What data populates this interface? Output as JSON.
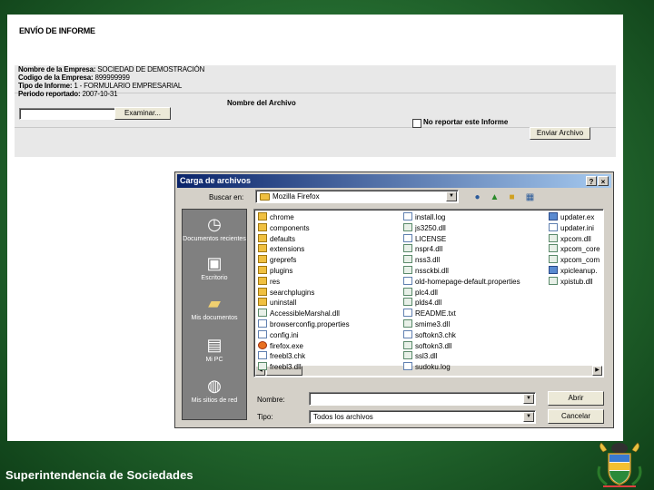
{
  "form": {
    "title": "ENVÍO DE INFORME",
    "empresa_label": "Nombre de la Empresa:",
    "empresa_value": "SOCIEDAD DE DEMOSTRACIÓN",
    "codigo_label": "Codigo de la Empresa:",
    "codigo_value": "899999999",
    "tipo_label": "Tipo de Informe:",
    "tipo_value": "1 - FORMULARIO EMPRESARIAL",
    "periodo_label": "Periodo reportado:",
    "periodo_value": "2007-10-31",
    "archivo_label": "Nombre del Archivo",
    "examinar_label": "Examinar...",
    "no_reportar_label": "No reportar este Informe",
    "enviar_label": "Enviar Archivo"
  },
  "dialog": {
    "title": "Carga de archivos",
    "help_glyph": "?",
    "close_glyph": "×",
    "buscar_label": "Buscar en:",
    "buscar_value": "Mozilla Firefox",
    "nombre_label": "Nombre:",
    "nombre_value": "",
    "tipo_label": "Tipo:",
    "tipo_value": "Todos los archivos",
    "abrir_label": "Abrir",
    "cancelar_label": "Cancelar",
    "places": [
      {
        "label": "Documentos recientes",
        "icon": "recent-documents-icon"
      },
      {
        "label": "Escritorio",
        "icon": "desktop-icon"
      },
      {
        "label": "Mis documentos",
        "icon": "my-documents-icon"
      },
      {
        "label": "Mi PC",
        "icon": "my-computer-icon"
      },
      {
        "label": "Mis sitios de red",
        "icon": "network-places-icon"
      }
    ],
    "files_col1": [
      {
        "name": "chrome",
        "type": "folder"
      },
      {
        "name": "components",
        "type": "folder"
      },
      {
        "name": "defaults",
        "type": "folder"
      },
      {
        "name": "extensions",
        "type": "folder"
      },
      {
        "name": "greprefs",
        "type": "folder"
      },
      {
        "name": "plugins",
        "type": "folder"
      },
      {
        "name": "res",
        "type": "folder"
      },
      {
        "name": "searchplugins",
        "type": "folder"
      },
      {
        "name": "uninstall",
        "type": "folder"
      },
      {
        "name": "AccessibleMarshal.dll",
        "type": "dll"
      },
      {
        "name": "browserconfig.properties",
        "type": "doc"
      },
      {
        "name": "config.ini",
        "type": "doc"
      },
      {
        "name": "firefox.exe",
        "type": "ff"
      },
      {
        "name": "freebl3.chk",
        "type": "doc"
      },
      {
        "name": "freebl3.dll",
        "type": "dll"
      }
    ],
    "files_col2": [
      {
        "name": "install.log",
        "type": "doc"
      },
      {
        "name": "js3250.dll",
        "type": "dll"
      },
      {
        "name": "LICENSE",
        "type": "doc"
      },
      {
        "name": "nspr4.dll",
        "type": "dll"
      },
      {
        "name": "nss3.dll",
        "type": "dll"
      },
      {
        "name": "nssckbi.dll",
        "type": "dll"
      },
      {
        "name": "old-homepage-default.properties",
        "type": "doc"
      },
      {
        "name": "plc4.dll",
        "type": "dll"
      },
      {
        "name": "plds4.dll",
        "type": "dll"
      },
      {
        "name": "README.txt",
        "type": "doc"
      },
      {
        "name": "smime3.dll",
        "type": "dll"
      },
      {
        "name": "softokn3.chk",
        "type": "doc"
      },
      {
        "name": "softokn3.dll",
        "type": "dll"
      },
      {
        "name": "ssl3.dll",
        "type": "dll"
      },
      {
        "name": "sudoku.log",
        "type": "doc"
      }
    ],
    "files_col3": [
      {
        "name": "updater.ex",
        "type": "exe"
      },
      {
        "name": "updater.ini",
        "type": "doc"
      },
      {
        "name": "xpcom.dll",
        "type": "dll"
      },
      {
        "name": "xpcom_core",
        "type": "dll"
      },
      {
        "name": "xpcom_com",
        "type": "dll"
      },
      {
        "name": "xpicleanup.",
        "type": "exe"
      },
      {
        "name": "xpistub.dll",
        "type": "dll"
      }
    ]
  },
  "footer": {
    "text": "Superintendencia de Sociedades"
  }
}
